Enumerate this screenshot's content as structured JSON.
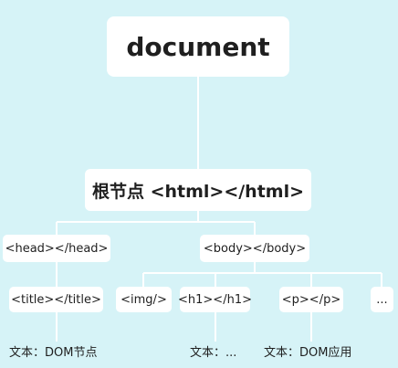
{
  "root": {
    "label": "document"
  },
  "html_node": {
    "label": "根节点 <html></html>"
  },
  "head_node": {
    "label": "<head></head>"
  },
  "body_node": {
    "label": "<body></body>"
  },
  "title_node": {
    "label": "<title></title>"
  },
  "img_node": {
    "label": "<img/>"
  },
  "h1_node": {
    "label": "<h1></h1>"
  },
  "p_node": {
    "label": "<p></p>"
  },
  "more_node": {
    "label": "..."
  },
  "text_title": {
    "label": "文本：DOM节点"
  },
  "text_h1": {
    "label": "文本：..."
  },
  "text_p": {
    "label": "文本：DOM应用"
  },
  "colors": {
    "background": "#d6f3f7",
    "node_fill": "#ffffff",
    "edge": "#ffffff",
    "text": "#1f1f1f"
  }
}
